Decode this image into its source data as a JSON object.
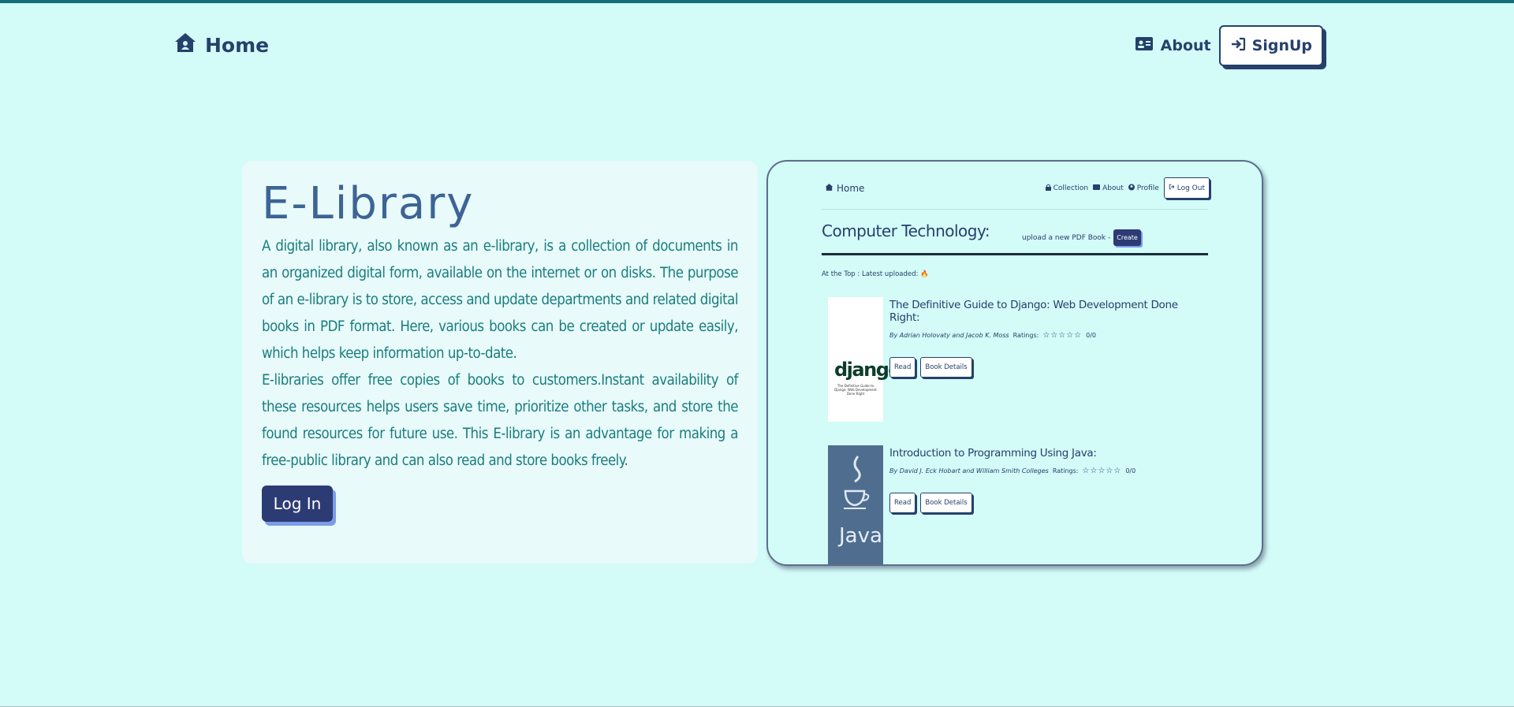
{
  "nav": {
    "home_label": "Home",
    "about_label": "About",
    "signup_label": "SignUp"
  },
  "hero": {
    "title": "E-Library",
    "paragraph1": "A digital library, also known as an e-library, is a collection of documents in an organized digital form, available on the internet or on disks. The purpose of an e-library is to store, access and update departments and related digital books in PDF format. Here, various books can be created or update easily, which helps keep information up-to-date.",
    "paragraph2": "E-libraries offer free copies of books to customers.Instant availability of these resources helps users save time, prioritize other tasks, and store the found resources for future use. This E-library is an advantage for making a free-public library and can also read and store books freely.",
    "login_label": "Log In"
  },
  "preview": {
    "nav": {
      "home_label": "Home",
      "collection_label": "Collection",
      "about_label": "About",
      "profile_label": "Profile",
      "logout_label": "Log Out"
    },
    "section_title": "Computer Technology:",
    "upload_text": "upload a new PDF Book -",
    "create_label": "Create",
    "latest_text": "At the Top : Latest uploaded:",
    "books": [
      {
        "title": "The Definitive Guide to Django: Web Development Done Right:",
        "authors": "By Adrian Holovaty and Jacob K. Moss",
        "ratings_label": "Ratings:",
        "stars": "☆☆☆☆☆",
        "score": "0/0",
        "cover_text": "django",
        "cover_subtext": "The Definitive Guide to Django: Web Development Done Right",
        "read_label": "Read",
        "details_label": "Book Details"
      },
      {
        "title": "Introduction to Programming Using Java:",
        "authors": "By David J. Eck Hobart and William Smith Colleges",
        "ratings_label": "Ratings:",
        "stars": "☆☆☆☆☆",
        "score": "0/0",
        "cover_text": "Java",
        "read_label": "Read",
        "details_label": "Book Details"
      }
    ]
  }
}
